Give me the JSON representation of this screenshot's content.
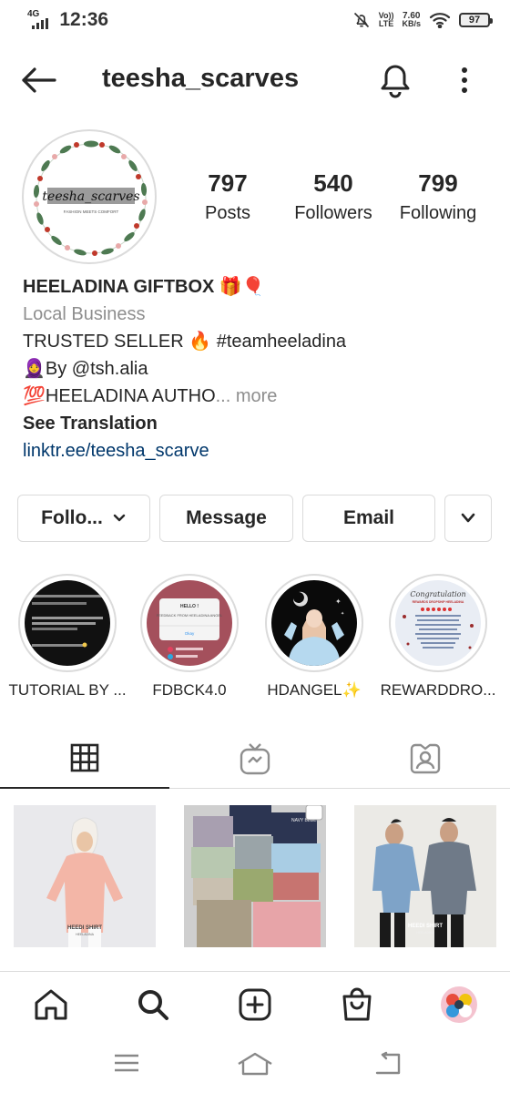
{
  "status_bar": {
    "network": "4G",
    "time": "12:36",
    "volte_line1": "Vo))",
    "volte_line2": "LTE",
    "speed_value": "7.60",
    "speed_unit": "KB/s",
    "battery": "97"
  },
  "header": {
    "username": "teesha_scarves"
  },
  "profile": {
    "avatar_text": "teesha_scarves",
    "avatar_subtext": "FASHION MEETS COMFORT",
    "stats": [
      {
        "value": "797",
        "label": "Posts"
      },
      {
        "value": "540",
        "label": "Followers"
      },
      {
        "value": "799",
        "label": "Following"
      }
    ]
  },
  "bio": {
    "name": "HEELADINA GIFTBOX 🎁🎈",
    "category": "Local Business",
    "line1": "TRUSTED SELLER 🔥 #teamheeladina",
    "line2": "🧕By @tsh.alia",
    "line3": "💯HEELADINA AUTHO",
    "more": "... more",
    "see_translation": "See Translation",
    "link": "linktr.ee/teesha_scarve"
  },
  "actions": {
    "follow": "Follo...",
    "message": "Message",
    "email": "Email"
  },
  "highlights": [
    {
      "label": "TUTORIAL BY ..."
    },
    {
      "label": "FDBCK4.0"
    },
    {
      "label": "HDANGEL✨"
    },
    {
      "label": "REWARDDRO..."
    }
  ],
  "highlight_content": {
    "fdbck_title": "HELLO !",
    "fdbck_body": "FEEDBACK FROM HEELADINA ANGEL",
    "fdbck_btn": "Okay",
    "reward_title": "Congratulation",
    "reward_sub": "REWARDS DROPSHIP HEELADINA"
  },
  "posts": [
    {
      "caption": "HEEDI SHIRT",
      "brand": "HEELADINA"
    },
    {
      "tag": "NAVY BLUE"
    },
    {
      "caption": "HEEDI SHIRT",
      "brand": "HEELADINA"
    }
  ],
  "colors": {
    "border": "#dbdbdb",
    "text": "#262626",
    "secondary": "#8e8e8e",
    "link": "#00376b"
  }
}
